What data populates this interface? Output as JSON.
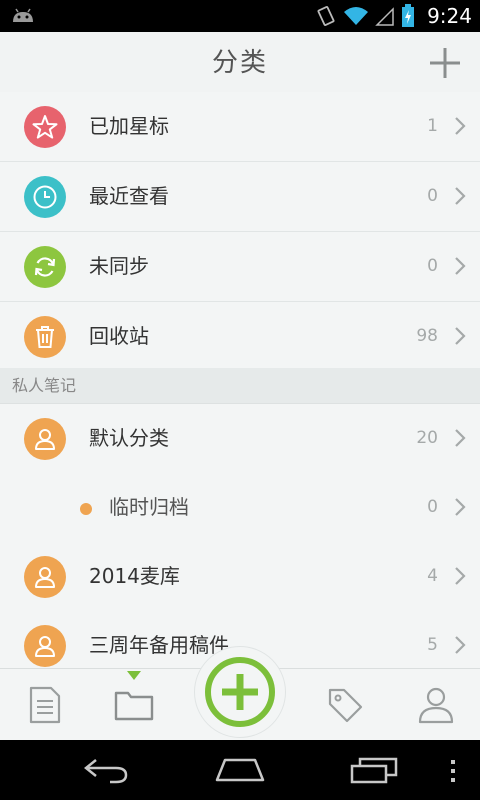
{
  "status_bar": {
    "time": "9:24"
  },
  "app_bar": {
    "title": "分类"
  },
  "rows": [
    {
      "label": "已加星标",
      "count": "1",
      "icon": "star-icon",
      "color": "#e7636d"
    },
    {
      "label": "最近查看",
      "count": "0",
      "icon": "clock-icon",
      "color": "#3cc0c8"
    },
    {
      "label": "未同步",
      "count": "0",
      "icon": "sync-icon",
      "color": "#8dc63f"
    },
    {
      "label": "回收站",
      "count": "98",
      "icon": "trash-icon",
      "color": "#efa451"
    }
  ],
  "section": {
    "title": "私人笔记"
  },
  "notebooks": [
    {
      "label": "默认分类",
      "count": "20",
      "icon": "person-icon",
      "color": "#efa451"
    },
    {
      "label": "临时归档",
      "count": "0",
      "icon": "dot-icon",
      "color": "#efa451"
    },
    {
      "label": "2014麦库",
      "count": "4",
      "icon": "person-icon",
      "color": "#efa451"
    },
    {
      "label": "三周年备用稿件",
      "count": "5",
      "icon": "person-icon",
      "color": "#efa451"
    }
  ],
  "bottom_tabs": {
    "notes": "document-icon",
    "categories": "folder-icon",
    "add": "plus-circle-icon",
    "tags": "tag-icon",
    "profile": "person-icon"
  },
  "accent_color": "#7cbf3a"
}
